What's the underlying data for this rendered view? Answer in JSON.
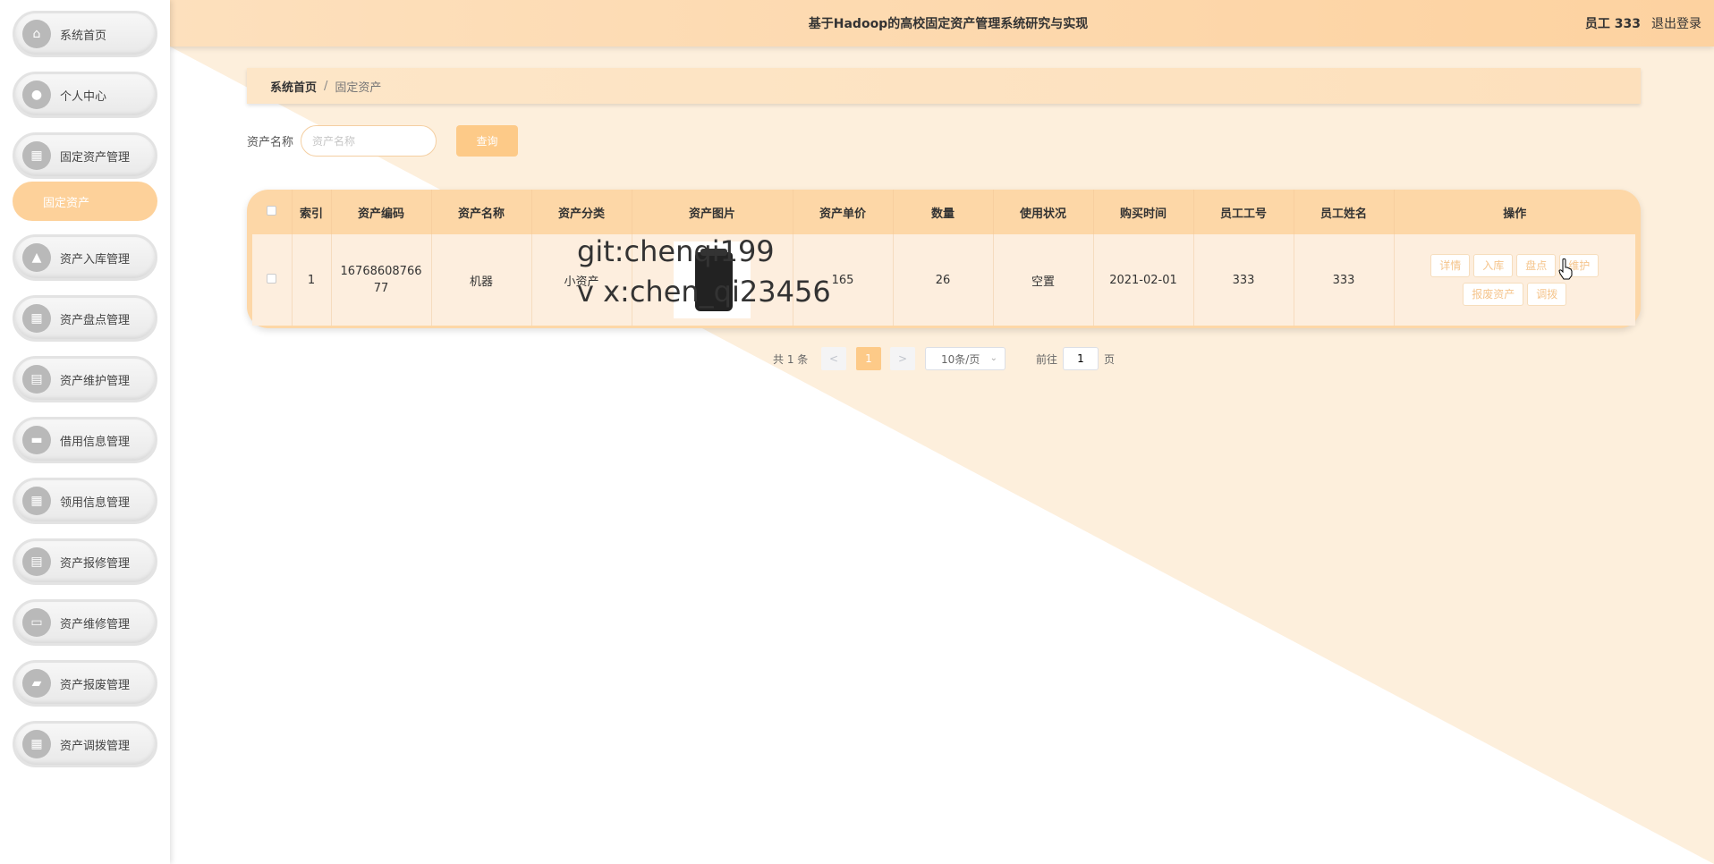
{
  "header": {
    "title": "基于Hadoop的高校固定资产管理系统研究与实现",
    "user": "员工 333",
    "logout": "退出登录"
  },
  "sidebar": {
    "items": [
      {
        "label": "系统首页",
        "icon": "home-icon"
      },
      {
        "label": "个人中心",
        "icon": "user-icon"
      },
      {
        "label": "固定资产管理",
        "icon": "grid-icon"
      },
      {
        "label": "资产入库管理",
        "icon": "thumb-up-icon"
      },
      {
        "label": "资产盘点管理",
        "icon": "grid-icon"
      },
      {
        "label": "资产维护管理",
        "icon": "clipboard-icon"
      },
      {
        "label": "借用信息管理",
        "icon": "ticket-icon"
      },
      {
        "label": "领用信息管理",
        "icon": "grid-icon"
      },
      {
        "label": "资产报修管理",
        "icon": "clipboard-icon"
      },
      {
        "label": "资产维修管理",
        "icon": "monitor-icon"
      },
      {
        "label": "资产报废管理",
        "icon": "chat-icon"
      },
      {
        "label": "资产调拨管理",
        "icon": "grid-icon"
      }
    ],
    "submenu": "固定资产"
  },
  "breadcrumb": {
    "home": "系统首页",
    "separator": "/",
    "current": "固定资产"
  },
  "search": {
    "label": "资产名称",
    "placeholder": "资产名称",
    "value": "",
    "button": "查询"
  },
  "table": {
    "headers": [
      "索引",
      "资产编码",
      "资产名称",
      "资产分类",
      "资产图片",
      "资产单价",
      "数量",
      "使用状况",
      "购买时间",
      "员工工号",
      "员工姓名",
      "操作"
    ],
    "rows": [
      {
        "index": "1",
        "code": "1676860876677",
        "name": "机器",
        "category": "小资产",
        "price": "165",
        "quantity": "26",
        "status": "空置",
        "buy_date": "2021-02-01",
        "emp_no": "333",
        "emp_name": "333",
        "actions": [
          "详情",
          "入库",
          "盘点",
          "维护",
          "报废资产",
          "调拨"
        ]
      }
    ]
  },
  "pagination": {
    "total": "共 1 条",
    "prev": "<",
    "current": "1",
    "next": ">",
    "page_size": "10条/页",
    "goto_label": "前往",
    "goto_value": "1",
    "page_unit": "页"
  },
  "watermark": {
    "line1": "git:chenqi199",
    "line2": "v x:chen_qi23456"
  },
  "colors": {
    "accent": "#fdca88",
    "header": "#fdd2a0",
    "sidebar_active": "#fdd19a"
  }
}
